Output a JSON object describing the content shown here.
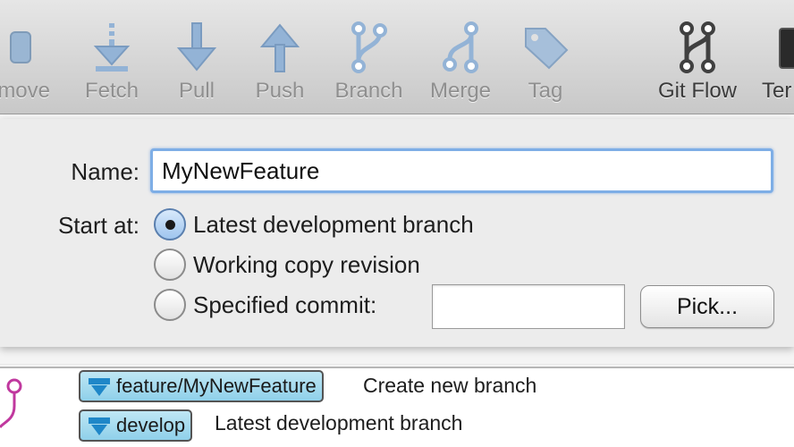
{
  "toolbar": {
    "items": [
      {
        "label": "emove",
        "icon": "remove-icon",
        "active": false
      },
      {
        "label": "Fetch",
        "icon": "fetch-icon",
        "active": false
      },
      {
        "label": "Pull",
        "icon": "pull-icon",
        "active": false
      },
      {
        "label": "Push",
        "icon": "push-icon",
        "active": false
      },
      {
        "label": "Branch",
        "icon": "branch-icon",
        "active": false
      },
      {
        "label": "Merge",
        "icon": "merge-icon",
        "active": false
      },
      {
        "label": "Tag",
        "icon": "tag-icon",
        "active": false
      },
      {
        "label": "Git Flow",
        "icon": "git-flow-icon",
        "active": true
      },
      {
        "label": "Ter",
        "icon": "terminal-icon",
        "active": true
      }
    ]
  },
  "dialog": {
    "name_label": "Name:",
    "name_value": "MyNewFeature",
    "start_label": "Start at:",
    "options": [
      {
        "label": "Latest development branch",
        "checked": true
      },
      {
        "label": "Working copy revision",
        "checked": false
      },
      {
        "label": "Specified commit:",
        "checked": false
      }
    ],
    "commit_value": "",
    "pick_label": "Pick..."
  },
  "log": {
    "rows": [
      {
        "branch": "feature/MyNewFeature",
        "message": "Create new branch"
      },
      {
        "branch": "develop",
        "message": "Latest development branch"
      }
    ]
  },
  "colors": {
    "accent": "#7eaee6",
    "branch_tag": "#9fd8ee",
    "graph_line": "#c0389e"
  }
}
